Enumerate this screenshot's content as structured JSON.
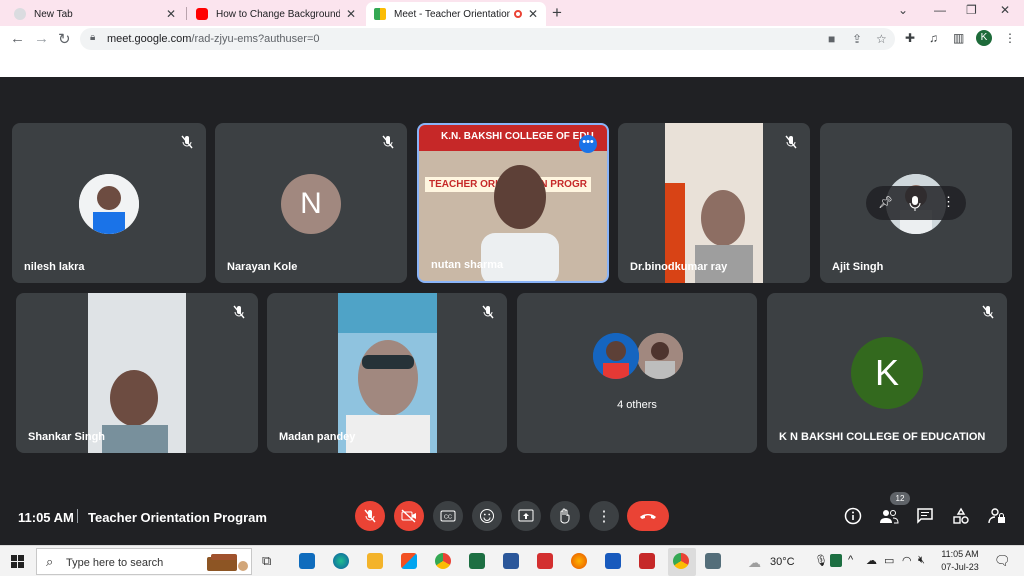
{
  "browser": {
    "tabs": [
      {
        "label": "New Tab"
      },
      {
        "label": "How to Change Background in G"
      },
      {
        "label": "Meet - Teacher Orientation P"
      }
    ],
    "url_host": "meet.google.com",
    "url_path": "/rad-zjyu-ems?authuser=0",
    "profile_initial": "K"
  },
  "meet": {
    "participants": [
      {
        "name": "nilesh lakra",
        "type": "photo"
      },
      {
        "name": "Narayan Kole",
        "type": "initial",
        "initial": "N",
        "color": "#a1887f"
      },
      {
        "name": "nutan sharma",
        "type": "video",
        "active": true
      },
      {
        "name": "Dr.binodkumar ray",
        "type": "video"
      },
      {
        "name": "Ajit Singh",
        "type": "photo"
      },
      {
        "name": "Shankar Singh",
        "type": "video"
      },
      {
        "name": "Madan pandey",
        "type": "video"
      },
      {
        "name": "",
        "type": "group"
      },
      {
        "name": "K N BAKSHI COLLEGE OF EDUCATION",
        "type": "initial",
        "initial": "K",
        "color": "#33691e"
      }
    ],
    "others_label": "4 others",
    "banner_line1": "K.N. BAKSHI COLLEGE OF EDU",
    "banner_line2": "TEACHER ORIENTATION PROGR",
    "time": "11:05 AM",
    "meeting_title": "Teacher Orientation Program",
    "people_count": "12",
    "accent_red": "#ea4335"
  },
  "taskbar": {
    "search_placeholder": "Type here to search",
    "weather": "30°C",
    "clock_time": "11:05 AM",
    "clock_date": "07-Jul-23"
  }
}
